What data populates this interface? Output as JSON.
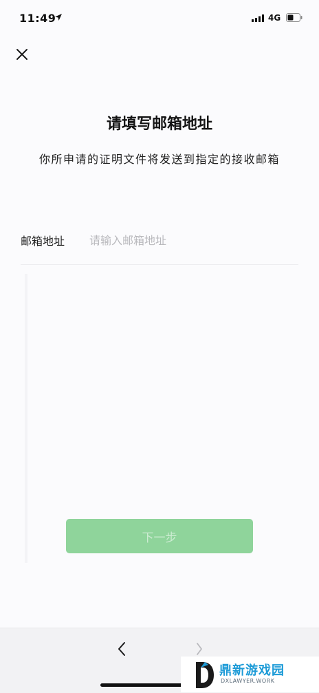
{
  "status_bar": {
    "time": "11:49",
    "network": "4G"
  },
  "header": {
    "close_icon": "close-icon"
  },
  "content": {
    "title": "请填写邮箱地址",
    "subtitle": "你所申请的证明文件将发送到指定的接收邮箱"
  },
  "form": {
    "email_label": "邮箱地址",
    "email_placeholder": "请输入邮箱地址",
    "email_value": ""
  },
  "actions": {
    "next_label": "下一步"
  },
  "bottom_nav": {
    "back_icon": "chevron-left-icon",
    "forward_icon": "chevron-right-icon"
  },
  "watermark": {
    "title": "鼎新游戏园",
    "subtitle": "DXLAWYER.WORK"
  },
  "colors": {
    "accent_green": "#8fd49b",
    "background": "#fbfbfd",
    "watermark_blue": "#1d9bd7"
  }
}
